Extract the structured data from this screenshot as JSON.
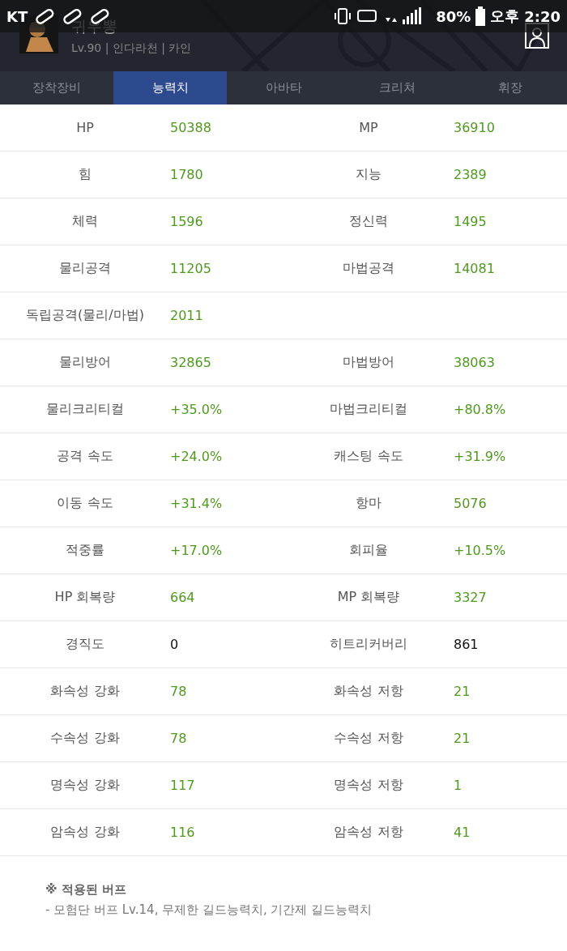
{
  "status_bar": {
    "carrier": "KT",
    "battery": "80%",
    "ampm": "오후",
    "time": "2:20"
  },
  "profile": {
    "name": "귀우뽕",
    "meta": "Lv.90 | 인다라천 | 카인"
  },
  "tabs": [
    {
      "label": "장착장비",
      "selected": false
    },
    {
      "label": "능력치",
      "selected": true
    },
    {
      "label": "아바타",
      "selected": false
    },
    {
      "label": "크리쳐",
      "selected": false
    },
    {
      "label": "휘장",
      "selected": false
    }
  ],
  "stats": [
    [
      {
        "label": "HP",
        "value": "50388",
        "color": "#4f9a1e"
      },
      {
        "label": "MP",
        "value": "36910",
        "color": "#4f9a1e"
      }
    ],
    [
      {
        "label": "힘",
        "value": "1780",
        "color": "#4f9a1e"
      },
      {
        "label": "지능",
        "value": "2389",
        "color": "#4f9a1e"
      }
    ],
    [
      {
        "label": "체력",
        "value": "1596",
        "color": "#4f9a1e"
      },
      {
        "label": "정신력",
        "value": "1495",
        "color": "#4f9a1e"
      }
    ],
    [
      {
        "label": "물리공격",
        "value": "11205",
        "color": "#4f9a1e"
      },
      {
        "label": "마법공격",
        "value": "14081",
        "color": "#4f9a1e"
      }
    ],
    [
      {
        "label": "독립공격(물리/마법)",
        "value": "2011",
        "color": "#4f9a1e"
      }
    ],
    [
      {
        "label": "물리방어",
        "value": "32865",
        "color": "#4f9a1e"
      },
      {
        "label": "마법방어",
        "value": "38063",
        "color": "#4f9a1e"
      }
    ],
    [
      {
        "label": "물리크리티컬",
        "value": "+35.0%",
        "color": "#4f9a1e"
      },
      {
        "label": "마법크리티컬",
        "value": "+80.8%",
        "color": "#4f9a1e"
      }
    ],
    [
      {
        "label": "공격 속도",
        "value": "+24.0%",
        "color": "#4f9a1e"
      },
      {
        "label": "캐스팅 속도",
        "value": "+31.9%",
        "color": "#4f9a1e"
      }
    ],
    [
      {
        "label": "이동 속도",
        "value": "+31.4%",
        "color": "#4f9a1e"
      },
      {
        "label": "항마",
        "value": "5076",
        "color": "#4f9a1e"
      }
    ],
    [
      {
        "label": "적중률",
        "value": "+17.0%",
        "color": "#4f9a1e"
      },
      {
        "label": "회피율",
        "value": "+10.5%",
        "color": "#4f9a1e"
      }
    ],
    [
      {
        "label": "HP 회복량",
        "value": "664",
        "color": "#4f9a1e"
      },
      {
        "label": "MP 회복량",
        "value": "3327",
        "color": "#4f9a1e"
      }
    ],
    [
      {
        "label": "경직도",
        "value": "0",
        "color": "#111111"
      },
      {
        "label": "히트리커버리",
        "value": "861",
        "color": "#111111"
      }
    ],
    [
      {
        "label": "화속성 강화",
        "value": "78",
        "color": "#4f9a1e"
      },
      {
        "label": "화속성 저항",
        "value": "21",
        "color": "#4f9a1e"
      }
    ],
    [
      {
        "label": "수속성 강화",
        "value": "78",
        "color": "#4f9a1e"
      },
      {
        "label": "수속성 저항",
        "value": "21",
        "color": "#4f9a1e"
      }
    ],
    [
      {
        "label": "명속성 강화",
        "value": "117",
        "color": "#4f9a1e"
      },
      {
        "label": "명속성 저항",
        "value": "1",
        "color": "#4f9a1e"
      }
    ],
    [
      {
        "label": "암속성 강화",
        "value": "116",
        "color": "#4f9a1e"
      },
      {
        "label": "암속성 저항",
        "value": "41",
        "color": "#4f9a1e"
      }
    ]
  ],
  "buffs": {
    "title": "※ 적용된 버프",
    "text": "- 모험단 버프 Lv.14, 무제한 길드능력치, 기간제 길드능력치"
  }
}
